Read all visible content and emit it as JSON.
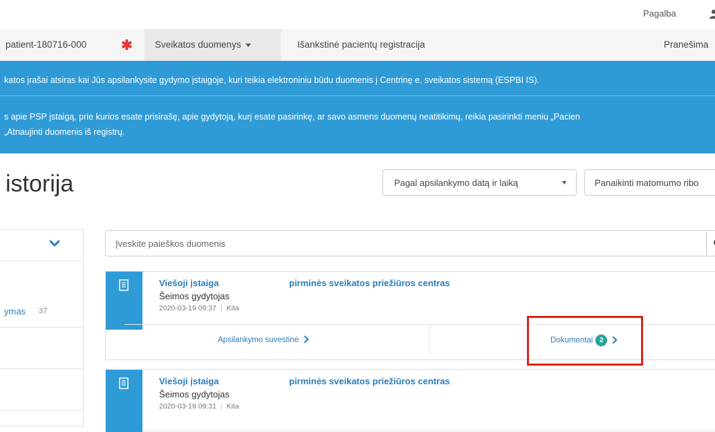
{
  "topbar": {
    "help_label": "Pagalba"
  },
  "nav": {
    "patient_id": "patient-180716-000",
    "health_data_label": "Sveikatos duomenys",
    "preregistration_label": "Išankstinė pacientų registracija",
    "notifications_label": "Pranešima"
  },
  "banner": {
    "line1": "katos įrašai atsiras kai Jūs apsilankysite gydymo įstaigoje, kuri teikia elektroniniu būdu duomenis į Centrinę e. sveikatos sistemą (ESPBI IS).",
    "line2": "s apie PSP įstaigą, prie kurios esate prisirašę, apie gydytoją, kurį esate pasirinkę, ar savo asmens duomenų neatitikimų, reikia pasirinkti meniu „Pacien",
    "line3": "„Atnaujinti duomenis iš registrų."
  },
  "page": {
    "title": "istorija",
    "sort_value": "Pagal apsilankymo datą ir laiką",
    "clear_label": "Panaikinti matomumo ribo"
  },
  "filters": {
    "items": [
      {
        "label": "ymas",
        "count": "37"
      }
    ]
  },
  "search": {
    "placeholder": "Įveskite paieškos duomenis"
  },
  "visits": [
    {
      "institution": "Viešoji įstaiga",
      "center": "pirminės sveikatos priežiūros centras",
      "specialty": "Šeimos gydytojas",
      "datetime": "2020-03-19 09:37",
      "type": "Kita",
      "summary_label": "Apsilankymo suvestinė",
      "documents_label": "Dokumentai",
      "documents_count": "2"
    },
    {
      "institution": "Viešoji įstaiga",
      "center": "pirminės sveikatos priežiūros centras",
      "specialty": "Šeimos gydytojas",
      "datetime": "2020-03-19 09:31",
      "type": "Kita"
    }
  ],
  "colors": {
    "accent": "#2f9bd6",
    "badge": "#2aa39a",
    "highlight": "#d9241c",
    "asterisk": "#e53935"
  }
}
